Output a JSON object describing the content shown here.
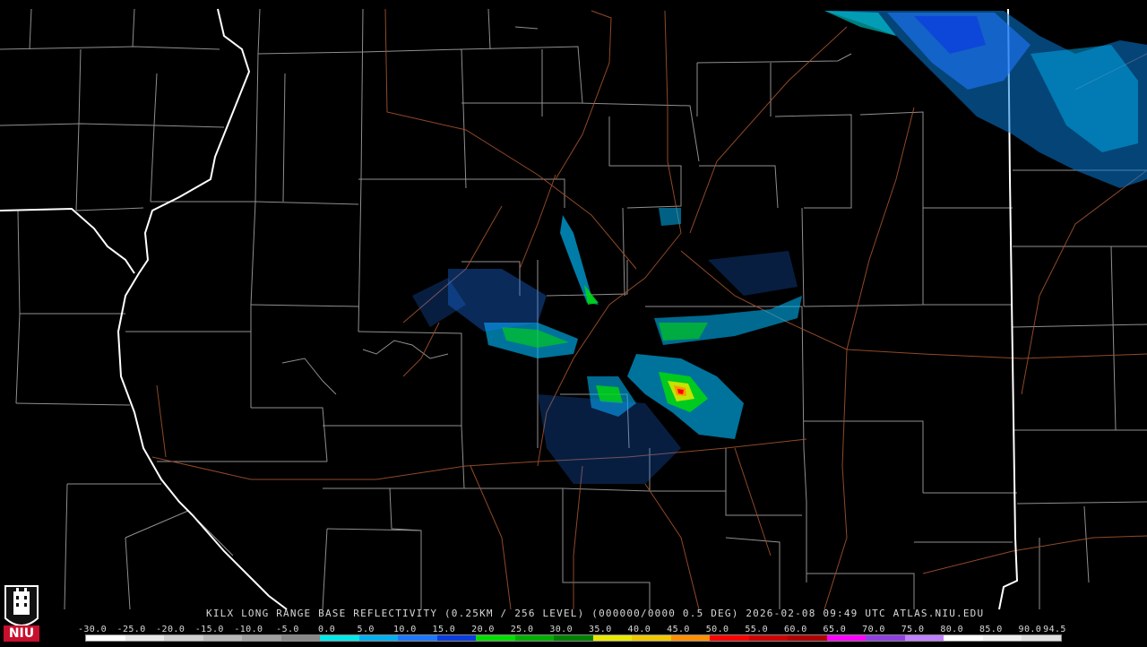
{
  "product_title": "KILX LONG RANGE BASE REFLECTIVITY (0.25KM / 256 LEVEL) (000000/0000 0.5 DEG) 2026-02-08 09:49 UTC  ATLAS.NIU.EDU",
  "logo_text": "NIU",
  "scale": {
    "labels": [
      "-30.0",
      "-25.0",
      "-20.0",
      "-15.0",
      "-10.0",
      "-5.0",
      "0.0",
      "5.0",
      "10.0",
      "15.0",
      "20.0",
      "25.0",
      "30.0",
      "35.0",
      "40.0",
      "45.0",
      "50.0",
      "55.0",
      "60.0",
      "65.0",
      "70.0",
      "75.0",
      "80.0",
      "85.0",
      "90.0",
      "94.5"
    ],
    "colors": [
      "#ffffff",
      "#e8e8e8",
      "#d0d0d0",
      "#b8b8b8",
      "#a0a0a0",
      "#888888",
      "#00e8e8",
      "#00b0f0",
      "#1e78ff",
      "#0a3ce0",
      "#00e000",
      "#00b000",
      "#008000",
      "#e8e800",
      "#f0c800",
      "#ff9000",
      "#ff0000",
      "#d00000",
      "#b00000",
      "#ff00ff",
      "#9040e0",
      "#c080ff",
      "#ffffff",
      "#f0f0f0",
      "#e0e0e0"
    ]
  },
  "colors": {
    "state_border": "#ffffff",
    "county_border": "#a8a8a8",
    "highway": "#a0522d",
    "background": "#000000"
  }
}
